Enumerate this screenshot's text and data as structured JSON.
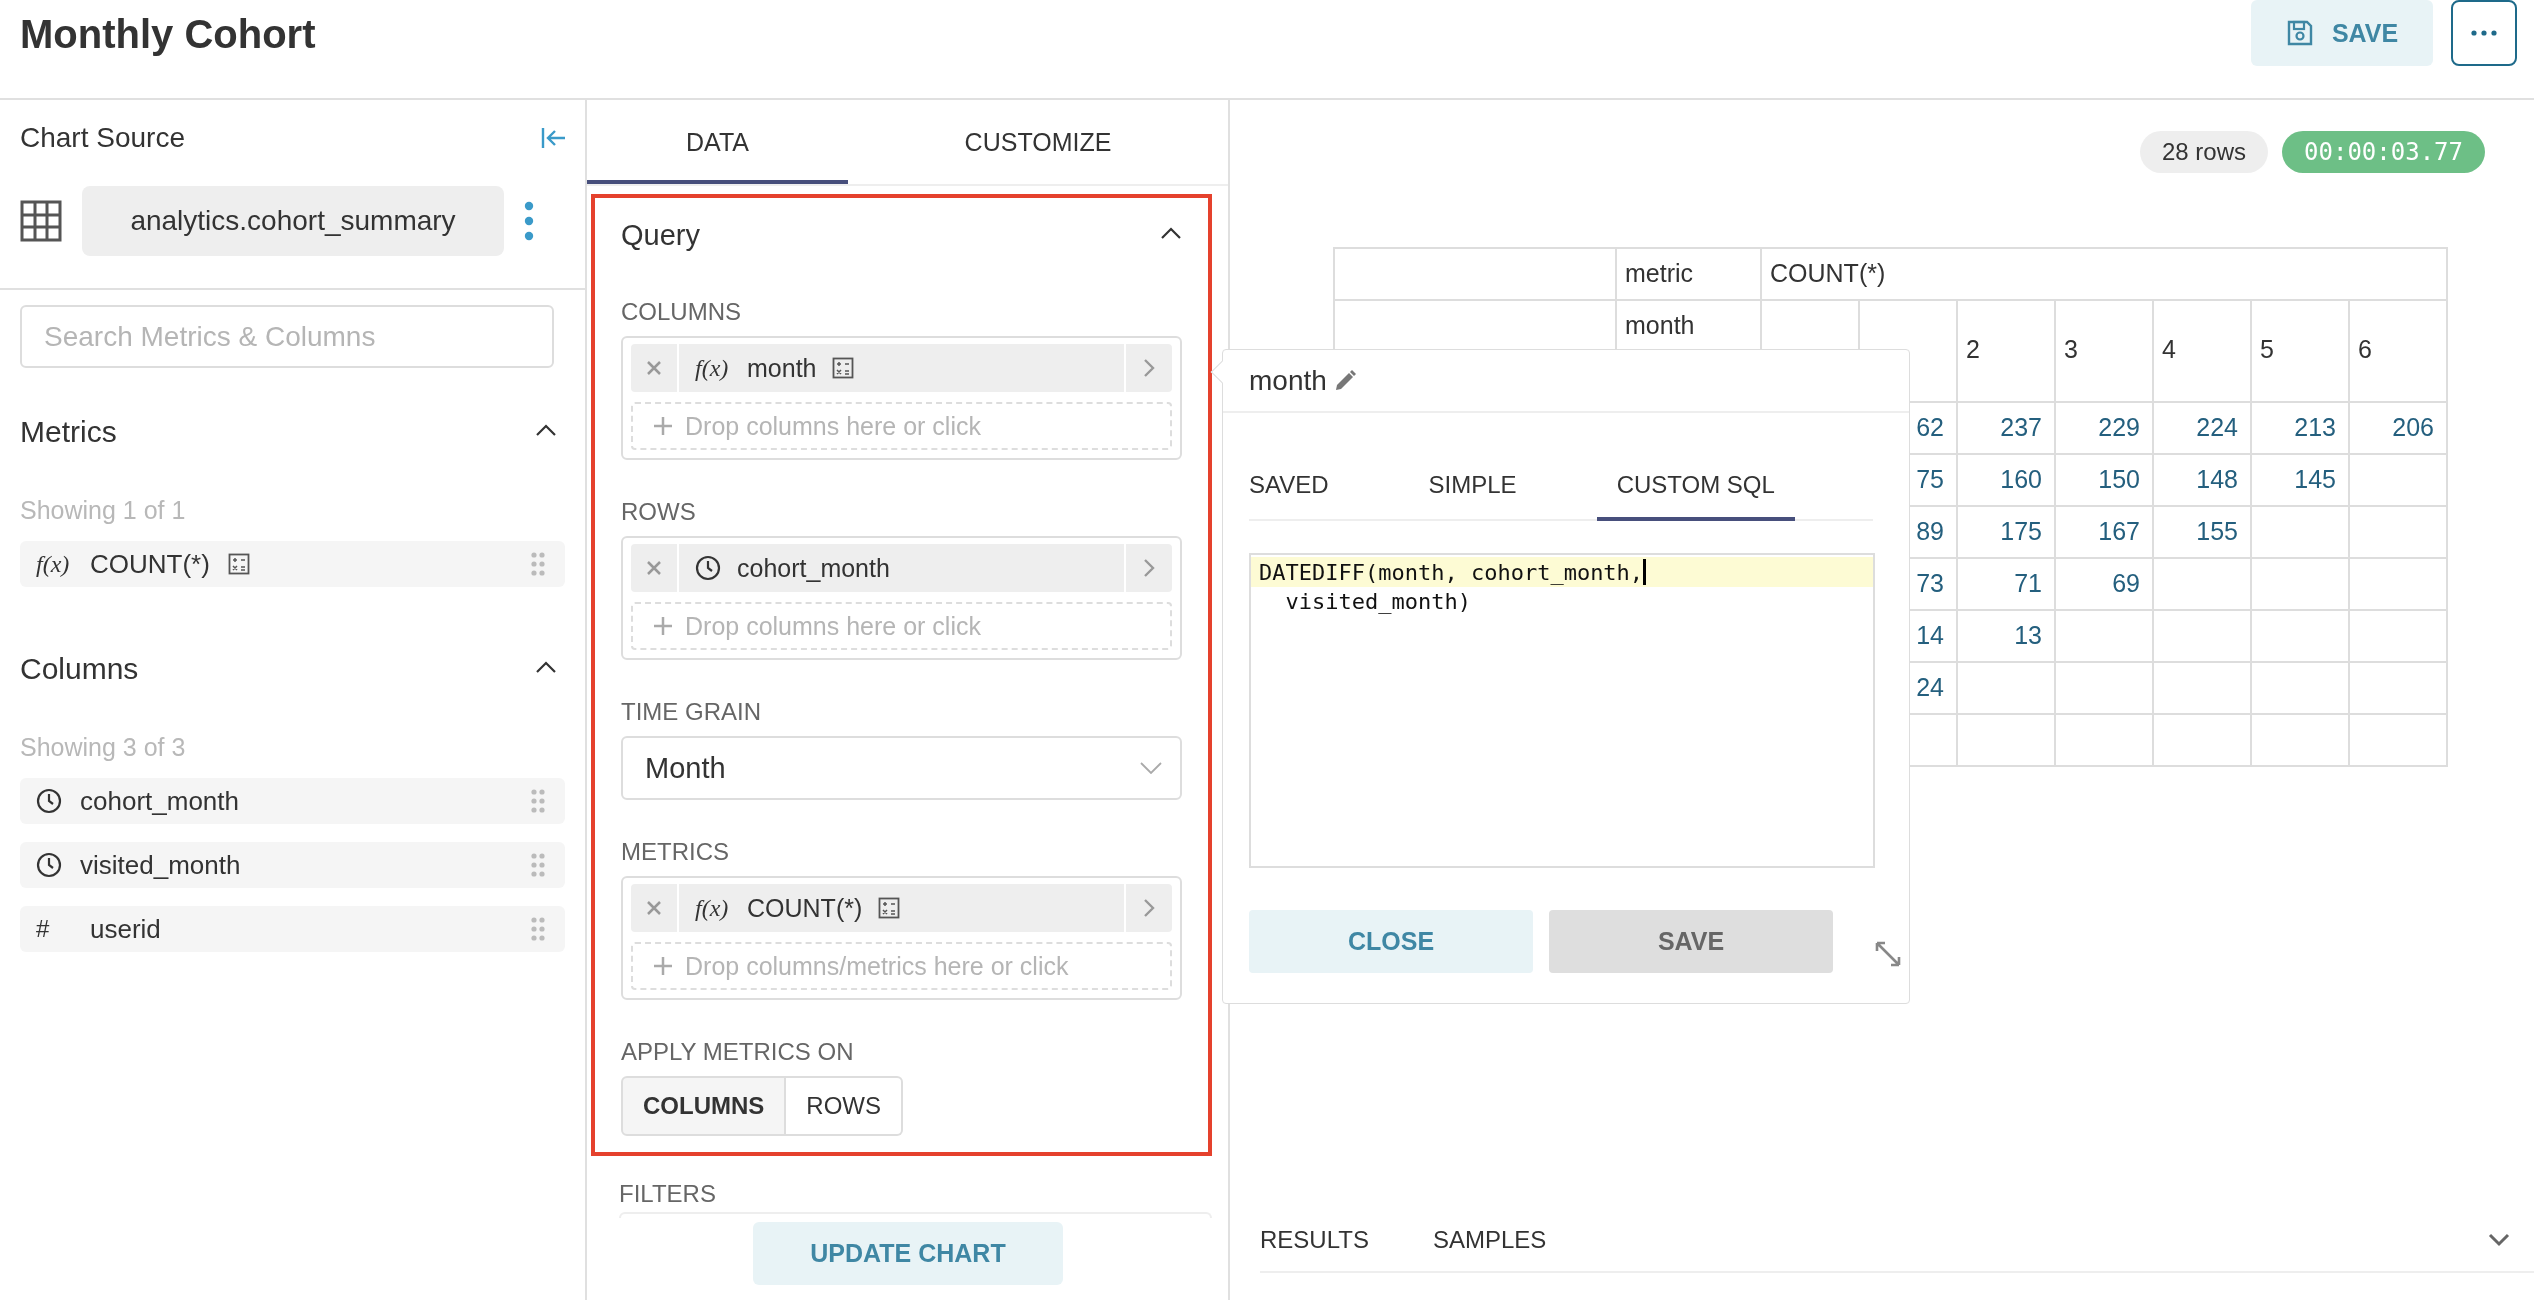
{
  "header": {
    "title": "Monthly Cohort",
    "save_label": "SAVE"
  },
  "source_panel": {
    "title": "Chart Source",
    "datasource": "analytics.cohort_summary",
    "search": {
      "placeholder": "Search Metrics & Columns"
    },
    "sections": [
      {
        "title": "Metrics",
        "expanded": true,
        "count": "Showing 1 of 1",
        "items": [
          {
            "kind": "function",
            "symbol": "f(x)",
            "label": "COUNT(*)",
            "sql": true
          }
        ]
      },
      {
        "title": "Columns",
        "expanded": true,
        "count": "Showing 3 of 3",
        "items": [
          {
            "kind": "time",
            "label": "cohort_month"
          },
          {
            "kind": "time",
            "label": "visited_month"
          },
          {
            "kind": "number",
            "symbol": "#",
            "label": "userid"
          }
        ]
      }
    ]
  },
  "control_panel": {
    "tabs": [
      {
        "label": "DATA",
        "selected": true
      },
      {
        "label": "CUSTOMIZE",
        "selected": false
      }
    ],
    "query": {
      "title": "Query",
      "expanded": true,
      "highlighted": true,
      "fields": [
        {
          "kind": "dropzone",
          "label": "COLUMNS",
          "chips": [
            {
              "kind": "function",
              "symbol": "f(x)",
              "label": "month",
              "sql": true
            }
          ],
          "placeholder": "Drop columns here or click"
        },
        {
          "kind": "dropzone",
          "label": "ROWS",
          "chips": [
            {
              "kind": "time",
              "label": "cohort_month"
            }
          ],
          "placeholder": "Drop columns here or click"
        },
        {
          "kind": "select",
          "label": "TIME GRAIN",
          "value": "Month"
        },
        {
          "kind": "dropzone",
          "label": "METRICS",
          "chips": [
            {
              "kind": "function",
              "symbol": "f(x)",
              "label": "COUNT(*)",
              "sql": true
            }
          ],
          "placeholder": "Drop columns/metrics here or click"
        },
        {
          "kind": "toggle",
          "label": "APPLY METRICS ON",
          "options": [
            {
              "label": "COLUMNS",
              "selected": true
            },
            {
              "label": "ROWS",
              "selected": false
            }
          ]
        }
      ]
    },
    "filters_label": "FILTERS",
    "update_button": "UPDATE CHART"
  },
  "results": {
    "row_count": "28 rows",
    "duration": "00:00:03.77",
    "table": {
      "metric_label": "metric",
      "metric": "COUNT(*)",
      "column_label": "month",
      "column_headers": [
        "2",
        "3",
        "4",
        "5",
        "6"
      ],
      "rows": [
        {
          "cells": [
            "62",
            "237",
            "229",
            "224",
            "213",
            "206"
          ]
        },
        {
          "cells": [
            "75",
            "160",
            "150",
            "148",
            "145"
          ]
        },
        {
          "cells": [
            "89",
            "175",
            "167",
            "155"
          ]
        },
        {
          "cells": [
            "73",
            "71",
            "69"
          ]
        },
        {
          "cells": [
            "14",
            "13"
          ]
        },
        {
          "cells": [
            "24"
          ]
        }
      ]
    },
    "tabs": [
      {
        "label": "RESULTS"
      },
      {
        "label": "SAMPLES"
      }
    ]
  },
  "popover": {
    "title": "month",
    "tabs": [
      {
        "label": "SAVED",
        "selected": false
      },
      {
        "label": "SIMPLE",
        "selected": false
      },
      {
        "label": "CUSTOM SQL",
        "selected": true
      }
    ],
    "sql_lines": [
      "DATEDIFF(month, cohort_month,",
      "  visited_month)"
    ],
    "close_label": "CLOSE",
    "save_label": "SAVE",
    "save_disabled": true
  }
}
